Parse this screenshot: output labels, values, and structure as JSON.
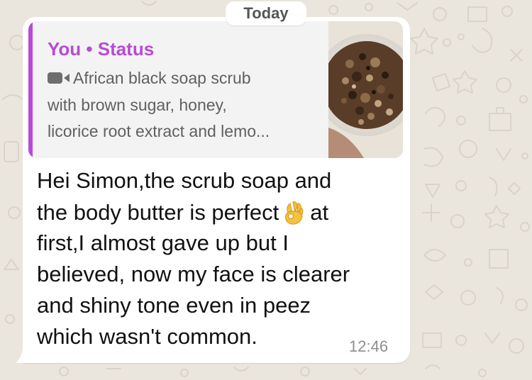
{
  "date_divider": "Today",
  "quoted_status": {
    "author": "You • Status",
    "media_type_icon": "video-camera-icon",
    "lines": [
      "African black soap scrub",
      "with brown sugar, honey,",
      "licorice root extract and lemo..."
    ],
    "accent_color": "#b84ad6",
    "thumbnail": "scrub-in-jar-photo"
  },
  "message": {
    "lines": [
      "Hei Simon,the scrub soap and",
      "the body butter is perfect",
      "at",
      "first,I almost gave up but I",
      "believed, now my face is clearer",
      "and shiny tone even in peez",
      "which wasn't common."
    ],
    "emoji": "ok-hand-emoji",
    "time": "12:46"
  },
  "colors": {
    "wallpaper": "#ebe6dd",
    "bubble": "#ffffff",
    "quote_background": "#f3f3f3"
  }
}
